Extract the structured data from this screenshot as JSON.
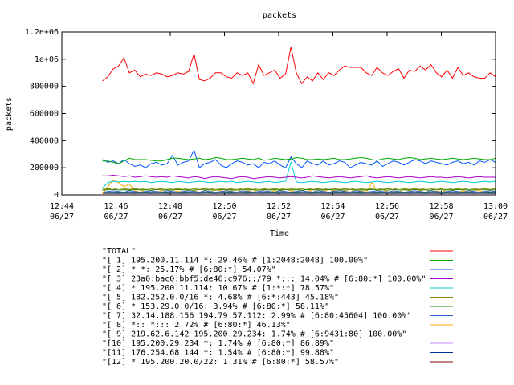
{
  "chart_data": {
    "type": "line",
    "title": "packets",
    "xlabel": "Time",
    "ylabel": "packets",
    "ylim": [
      0,
      1200000
    ],
    "yticks": [
      {
        "value": 0,
        "label": "0"
      },
      {
        "value": 200000,
        "label": "200000"
      },
      {
        "value": 400000,
        "label": "400000"
      },
      {
        "value": 600000,
        "label": "600000"
      },
      {
        "value": 800000,
        "label": "800000"
      },
      {
        "value": 1000000,
        "label": "1e+06"
      },
      {
        "value": 1200000,
        "label": "1.2e+06"
      }
    ],
    "xticks": [
      {
        "time": "12:44",
        "date": "06/27"
      },
      {
        "time": "12:46",
        "date": "06/27"
      },
      {
        "time": "12:48",
        "date": "06/27"
      },
      {
        "time": "12:50",
        "date": "06/27"
      },
      {
        "time": "12:52",
        "date": "06/27"
      },
      {
        "time": "12:54",
        "date": "06/27"
      },
      {
        "time": "12:56",
        "date": "06/27"
      },
      {
        "time": "12:58",
        "date": "06/27"
      },
      {
        "time": "13:00",
        "date": "06/27"
      }
    ],
    "xlim": [
      "12:44",
      "13:00"
    ],
    "x_start": "12:45:30",
    "x_end": "13:00",
    "grid": false,
    "legend_position": "bottom",
    "series": [
      {
        "name": "\"TOTAL\"",
        "color": "#ff0000",
        "values": [
          840000,
          870000,
          930000,
          950000,
          1010000,
          900000,
          920000,
          870000,
          890000,
          880000,
          900000,
          890000,
          870000,
          880000,
          900000,
          890000,
          910000,
          1040000,
          850000,
          840000,
          860000,
          900000,
          900000,
          870000,
          860000,
          900000,
          880000,
          900000,
          820000,
          960000,
          880000,
          900000,
          920000,
          860000,
          890000,
          1090000,
          900000,
          820000,
          870000,
          840000,
          900000,
          850000,
          900000,
          880000,
          920000,
          950000,
          940000,
          940000,
          940000,
          900000,
          880000,
          940000,
          900000,
          880000,
          910000,
          930000,
          860000,
          920000,
          910000,
          950000,
          920000,
          960000,
          900000,
          870000,
          920000,
          860000,
          940000,
          880000,
          900000,
          870000,
          860000,
          860000,
          900000,
          870000
        ]
      },
      {
        "name": "\"[ 1] 195.200.11.114 *: 29.46% # [1:2048:2048] 100.00%\"",
        "color": "#00aa00",
        "values": [
          250000,
          250000,
          240000,
          230000,
          250000,
          270000,
          260000,
          260000,
          260000,
          255000,
          250000,
          250000,
          260000,
          270000,
          270000,
          265000,
          260000,
          265000,
          270000,
          260000,
          265000,
          275000,
          270000,
          260000,
          260000,
          265000,
          270000,
          265000,
          260000,
          270000,
          255000,
          260000,
          270000,
          265000,
          260000,
          265000,
          275000,
          270000,
          260000,
          260000,
          265000,
          260000,
          265000,
          270000,
          260000,
          260000,
          265000,
          270000,
          275000,
          270000,
          260000,
          255000,
          265000,
          270000,
          265000,
          260000,
          270000,
          275000,
          270000,
          260000,
          265000,
          270000,
          265000,
          260000,
          265000,
          270000,
          265000,
          260000,
          265000,
          270000,
          265000,
          260000,
          260000,
          270000
        ]
      },
      {
        "name": "\"[ 2] * *: 25.17% # [6:80:*] 54.07%\"",
        "color": "#0055ff",
        "values": [
          260000,
          240000,
          250000,
          230000,
          260000,
          230000,
          210000,
          220000,
          200000,
          230000,
          240000,
          220000,
          230000,
          290000,
          220000,
          240000,
          250000,
          330000,
          200000,
          230000,
          240000,
          260000,
          220000,
          200000,
          230000,
          250000,
          240000,
          220000,
          230000,
          200000,
          240000,
          230000,
          250000,
          220000,
          200000,
          280000,
          230000,
          200000,
          250000,
          230000,
          220000,
          250000,
          220000,
          230000,
          250000,
          240000,
          200000,
          220000,
          240000,
          230000,
          220000,
          250000,
          210000,
          230000,
          250000,
          240000,
          220000,
          240000,
          260000,
          250000,
          230000,
          250000,
          240000,
          230000,
          220000,
          240000,
          250000,
          230000,
          240000,
          220000,
          250000,
          240000,
          260000,
          240000
        ]
      },
      {
        "name": "\"[ 3] 23a0:bac0:bbf5:de46:c976::/79 *::: 14.04% # [6:80:*] 100.00%\"",
        "color": "#aa00cc",
        "values": [
          140000,
          140000,
          145000,
          140000,
          135000,
          140000,
          130000,
          135000,
          140000,
          135000,
          130000,
          135000,
          130000,
          140000,
          135000,
          130000,
          125000,
          135000,
          130000,
          120000,
          130000,
          135000,
          130000,
          125000,
          120000,
          130000,
          135000,
          130000,
          120000,
          125000,
          130000,
          135000,
          130000,
          125000,
          130000,
          135000,
          130000,
          125000,
          130000,
          140000,
          135000,
          130000,
          125000,
          130000,
          135000,
          130000,
          125000,
          130000,
          135000,
          140000,
          130000,
          125000,
          130000,
          135000,
          130000,
          125000,
          130000,
          135000,
          130000,
          125000,
          130000,
          135000,
          130000,
          130000,
          125000,
          130000,
          135000,
          130000,
          125000,
          130000,
          135000,
          130000,
          130000,
          130000
        ]
      },
      {
        "name": "\"[ 4] * 195.200.11.114: 10.67% # [1:*:*] 78.57%\"",
        "color": "#00cccc",
        "values": [
          50000,
          90000,
          100000,
          95000,
          100000,
          95000,
          100000,
          95000,
          100000,
          90000,
          95000,
          100000,
          95000,
          90000,
          100000,
          95000,
          90000,
          95000,
          100000,
          95000,
          90000,
          95000,
          100000,
          95000,
          100000,
          90000,
          95000,
          100000,
          95000,
          90000,
          95000,
          100000,
          90000,
          95000,
          100000,
          240000,
          95000,
          90000,
          95000,
          100000,
          95000,
          90000,
          95000,
          100000,
          95000,
          90000,
          95000,
          100000,
          95000,
          90000,
          95000,
          100000,
          95000,
          90000,
          95000,
          100000,
          95000,
          90000,
          95000,
          100000,
          95000,
          90000,
          95000,
          100000,
          95000,
          90000,
          95000,
          100000,
          95000,
          90000,
          95000,
          100000,
          95000,
          100000
        ]
      },
      {
        "name": "\"[ 5] 182.252.0.0/16 *: 4.68% # [6:*:443] 45.18%\"",
        "color": "#888800",
        "values": [
          40000,
          45000,
          40000,
          50000,
          45000,
          40000,
          45000,
          40000,
          50000,
          45000,
          40000,
          45000,
          50000,
          40000,
          45000,
          40000,
          50000,
          45000,
          40000,
          45000,
          40000,
          50000,
          45000,
          40000,
          45000,
          50000,
          40000,
          45000,
          40000,
          50000,
          45000,
          40000,
          45000,
          40000,
          50000,
          45000,
          40000,
          45000,
          50000,
          40000,
          45000,
          40000,
          50000,
          45000,
          40000,
          45000,
          40000,
          50000,
          45000,
          40000,
          45000,
          50000,
          40000,
          45000,
          40000,
          50000,
          45000,
          40000,
          45000,
          40000,
          50000,
          45000,
          40000,
          45000,
          50000,
          40000,
          45000,
          40000,
          50000,
          45000,
          40000,
          45000,
          40000,
          45000
        ]
      },
      {
        "name": "\"[ 6] * 153.29.0.0/16: 3.94% # [6:80:*] 58.11%\"",
        "color": "#228800",
        "values": [
          35000,
          38000,
          40000,
          36000,
          38000,
          35000,
          40000,
          36000,
          38000,
          35000,
          40000,
          36000,
          38000,
          35000,
          40000,
          36000,
          38000,
          35000,
          40000,
          36000,
          38000,
          35000,
          40000,
          36000,
          38000,
          35000,
          40000,
          36000,
          38000,
          35000,
          40000,
          36000,
          38000,
          35000,
          40000,
          36000,
          38000,
          35000,
          40000,
          36000,
          38000,
          35000,
          40000,
          36000,
          38000,
          35000,
          40000,
          36000,
          38000,
          35000,
          40000,
          36000,
          38000,
          35000,
          40000,
          36000,
          38000,
          35000,
          40000,
          36000,
          38000,
          35000,
          40000,
          36000,
          38000,
          35000,
          40000,
          36000,
          38000,
          35000,
          40000,
          36000,
          38000,
          36000
        ]
      },
      {
        "name": "\"[ 7] 32.14.188.156 194.79.57.112: 2.99% # [6:80:45604] 100.00%\"",
        "color": "#3366cc",
        "values": [
          20000,
          25000,
          30000,
          25000,
          20000,
          30000,
          25000,
          20000,
          25000,
          30000,
          25000,
          20000,
          30000,
          25000,
          20000,
          25000,
          30000,
          25000,
          20000,
          30000,
          25000,
          20000,
          25000,
          30000,
          25000,
          20000,
          30000,
          25000,
          20000,
          25000,
          30000,
          25000,
          20000,
          30000,
          25000,
          20000,
          25000,
          30000,
          25000,
          20000,
          30000,
          25000,
          20000,
          25000,
          30000,
          25000,
          20000,
          30000,
          25000,
          20000,
          25000,
          30000,
          25000,
          20000,
          30000,
          25000,
          20000,
          25000,
          30000,
          25000,
          20000,
          30000,
          25000,
          20000,
          25000,
          30000,
          25000,
          20000,
          30000,
          25000,
          20000,
          25000,
          30000,
          25000
        ]
      },
      {
        "name": "\"[ 8] *:: *::: 2.72% # [6:80:*] 46.13%\"",
        "color": "#ffaa00",
        "values": [
          10000,
          60000,
          110000,
          90000,
          60000,
          80000,
          30000,
          20000,
          40000,
          30000,
          20000,
          30000,
          40000,
          20000,
          30000,
          20000,
          40000,
          30000,
          20000,
          30000,
          20000,
          40000,
          30000,
          20000,
          30000,
          40000,
          20000,
          30000,
          20000,
          40000,
          30000,
          20000,
          30000,
          20000,
          40000,
          30000,
          20000,
          30000,
          40000,
          20000,
          30000,
          20000,
          40000,
          30000,
          20000,
          30000,
          20000,
          40000,
          30000,
          20000,
          90000,
          30000,
          40000,
          20000,
          30000,
          20000,
          40000,
          30000,
          20000,
          30000,
          40000,
          20000,
          30000,
          20000,
          40000,
          30000,
          20000,
          30000,
          20000,
          40000,
          30000,
          20000,
          30000,
          20000
        ]
      },
      {
        "name": "\"[ 9] 219.62.6.142 195.200.29.234: 1.74% # [6:9431:80] 100.00%\"",
        "color": "#006666",
        "values": [
          15000,
          18000,
          16000,
          17000,
          15000,
          18000,
          16000,
          17000,
          15000,
          18000,
          16000,
          17000,
          15000,
          18000,
          16000,
          17000,
          15000,
          18000,
          16000,
          17000,
          15000,
          18000,
          16000,
          17000,
          15000,
          18000,
          16000,
          17000,
          15000,
          18000,
          16000,
          17000,
          15000,
          18000,
          16000,
          17000,
          15000,
          18000,
          16000,
          17000,
          15000,
          18000,
          16000,
          17000,
          15000,
          18000,
          16000,
          17000,
          15000,
          18000,
          16000,
          17000,
          15000,
          18000,
          16000,
          17000,
          15000,
          18000,
          16000,
          17000,
          15000,
          18000,
          16000,
          17000,
          15000,
          18000,
          16000,
          17000,
          15000,
          18000,
          16000,
          17000,
          15000,
          17000
        ]
      },
      {
        "name": "\"[10] 195.200.29.234 *: 1.74% # [6:80:*] 86.89%\"",
        "color": "#cc88ff",
        "values": [
          14000,
          16000,
          15000,
          17000,
          14000,
          16000,
          15000,
          17000,
          14000,
          16000,
          15000,
          17000,
          14000,
          16000,
          15000,
          17000,
          14000,
          16000,
          15000,
          17000,
          14000,
          16000,
          15000,
          17000,
          14000,
          16000,
          15000,
          17000,
          14000,
          16000,
          15000,
          17000,
          14000,
          16000,
          15000,
          17000,
          14000,
          16000,
          15000,
          17000,
          14000,
          16000,
          15000,
          17000,
          14000,
          16000,
          15000,
          17000,
          14000,
          16000,
          15000,
          17000,
          14000,
          16000,
          15000,
          17000,
          14000,
          16000,
          15000,
          17000,
          14000,
          16000,
          15000,
          17000,
          14000,
          16000,
          15000,
          17000,
          14000,
          16000,
          15000,
          17000,
          14000,
          16000
        ]
      },
      {
        "name": "\"[11] 176.254.68.144 *: 1.54% # [6:80:*] 99.88%\"",
        "color": "#003399",
        "values": [
          12000,
          14000,
          13000,
          12000,
          14000,
          13000,
          12000,
          14000,
          13000,
          12000,
          14000,
          13000,
          12000,
          14000,
          13000,
          12000,
          14000,
          13000,
          12000,
          14000,
          13000,
          12000,
          14000,
          13000,
          12000,
          14000,
          13000,
          12000,
          14000,
          13000,
          12000,
          14000,
          13000,
          12000,
          14000,
          13000,
          12000,
          14000,
          13000,
          12000,
          14000,
          13000,
          12000,
          14000,
          13000,
          12000,
          14000,
          13000,
          12000,
          14000,
          13000,
          12000,
          14000,
          13000,
          12000,
          14000,
          13000,
          12000,
          14000,
          13000,
          12000,
          14000,
          13000,
          12000,
          14000,
          13000,
          12000,
          14000,
          13000,
          12000,
          14000,
          13000,
          12000,
          13000
        ]
      },
      {
        "name": "\"[12] * 195.200.20.0/22: 1.31% # [6:80:*] 58.57%\"",
        "color": "#880000",
        "values": [
          10000,
          12000,
          11000,
          10000,
          12000,
          11000,
          10000,
          12000,
          11000,
          10000,
          12000,
          11000,
          10000,
          12000,
          11000,
          10000,
          12000,
          11000,
          10000,
          12000,
          11000,
          10000,
          12000,
          11000,
          10000,
          12000,
          11000,
          10000,
          12000,
          11000,
          10000,
          12000,
          11000,
          10000,
          12000,
          11000,
          10000,
          12000,
          11000,
          10000,
          12000,
          11000,
          10000,
          12000,
          11000,
          10000,
          12000,
          11000,
          10000,
          12000,
          11000,
          10000,
          12000,
          11000,
          10000,
          12000,
          11000,
          10000,
          12000,
          11000,
          10000,
          12000,
          11000,
          10000,
          12000,
          11000,
          10000,
          12000,
          11000,
          10000,
          12000,
          11000,
          10000,
          11000
        ]
      }
    ]
  }
}
